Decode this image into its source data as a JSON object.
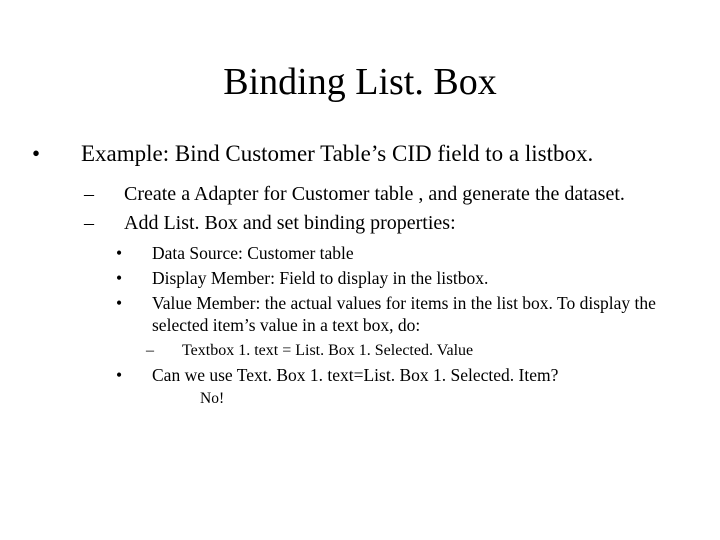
{
  "title": "Binding List. Box",
  "bullets": {
    "l1": "Example: Bind Customer Table’s CID field to a listbox.",
    "l2a": "Create a Adapter for Customer table , and generate the dataset.",
    "l2b": "Add List. Box and set binding properties:",
    "l3a": "Data Source: Customer table",
    "l3b": "Display Member: Field to display in the listbox.",
    "l3c": "Value Member: the actual values for items in the list box.  To display the selected item’s value in a text box, do:",
    "l4a": "Textbox 1. text = List. Box 1. Selected. Value",
    "l3d": "Can we use Text. Box 1. text=List. Box 1. Selected. Item?",
    "l5a": "No!"
  }
}
